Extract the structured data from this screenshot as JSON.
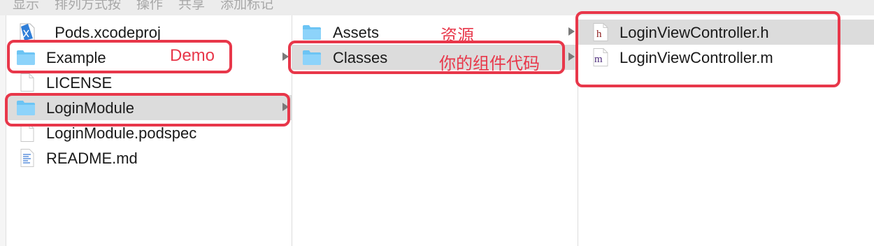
{
  "toolbar": {
    "items": [
      "显示",
      "排列方式按",
      "操作",
      "共享",
      "添加标记"
    ]
  },
  "columns": {
    "root": [
      {
        "label": "_Pods.xcodeproj",
        "icon": "xcodeproj-icon",
        "selected": false
      },
      {
        "label": "Example",
        "icon": "folder-icon",
        "selected": false,
        "has_children": true
      },
      {
        "label": "LICENSE",
        "icon": "document-icon",
        "selected": false
      },
      {
        "label": "LoginModule",
        "icon": "folder-icon",
        "selected": true,
        "has_children": true
      },
      {
        "label": "LoginModule.podspec",
        "icon": "document-icon",
        "selected": false
      },
      {
        "label": "README.md",
        "icon": "text-document-icon",
        "selected": false
      }
    ],
    "login_module": [
      {
        "label": "Assets",
        "icon": "folder-icon",
        "selected": false,
        "has_children": true
      },
      {
        "label": "Classes",
        "icon": "folder-icon",
        "selected": true,
        "has_children": true
      }
    ],
    "classes": [
      {
        "label": "LoginViewController.h",
        "icon": "header-file-icon",
        "glyph": "h",
        "selected": true
      },
      {
        "label": "LoginViewController.m",
        "icon": "objc-source-file-icon",
        "glyph": "m",
        "selected": false
      }
    ]
  },
  "annotations": {
    "demo": "Demo",
    "resources": "资源",
    "your_component_code": "你的组件代码"
  },
  "colors": {
    "annotation": "#e8374a",
    "folder": "#6cc4f4",
    "selection": "#dcdcdc",
    "h_glyph": "#8b1a1a",
    "m_glyph": "#4b2a7a"
  }
}
